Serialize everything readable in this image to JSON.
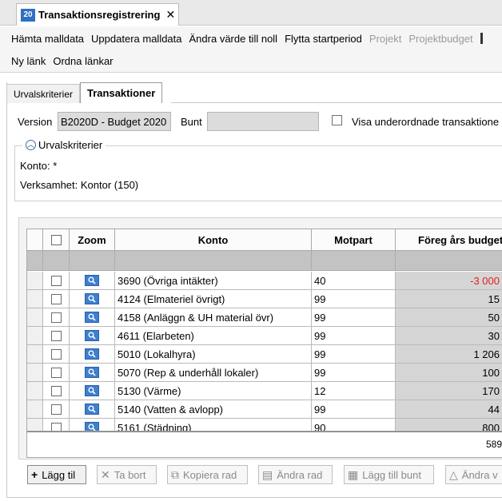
{
  "window": {
    "tab_icon_text": "20",
    "tab_title": "Transaktionsregistrering",
    "close_glyph": "✕"
  },
  "toolbar": {
    "row1": [
      {
        "label": "Hämta malldata",
        "enabled": true
      },
      {
        "label": "Uppdatera malldata",
        "enabled": true
      },
      {
        "label": "Ändra värde till noll",
        "enabled": true
      },
      {
        "label": "Flytta startperiod",
        "enabled": true
      },
      {
        "label": "Projekt",
        "enabled": false
      },
      {
        "label": "Projektbudget",
        "enabled": false
      }
    ],
    "row2": [
      {
        "label": "Ny länk",
        "enabled": true
      },
      {
        "label": "Ordna länkar",
        "enabled": true
      }
    ]
  },
  "tabs": [
    {
      "label": "Urvalskriterier",
      "active": false
    },
    {
      "label": "Transaktioner",
      "active": true
    }
  ],
  "form": {
    "version_label": "Version",
    "version_value": "B2020D - Budget 2020",
    "bunt_label": "Bunt",
    "bunt_value": "",
    "show_sub_label": "Visa underordnade transaktione"
  },
  "criteria": {
    "legend": "Urvalskriterier",
    "line1": "Konto: *",
    "line2": "Verksamhet: Kontor (150)"
  },
  "grid": {
    "headers": {
      "zoom": "Zoom",
      "konto": "Konto",
      "motpart": "Motpart",
      "budget": "Föreg års budget"
    },
    "rows": [
      {
        "konto": "3690 (Övriga intäkter)",
        "motpart": "40",
        "budget": "-3 000",
        "negative": true
      },
      {
        "konto": "4124 (Elmateriel övrigt)",
        "motpart": "99",
        "budget": "15",
        "negative": false
      },
      {
        "konto": "4158 (Anläggn & UH material övr)",
        "motpart": "99",
        "budget": "50",
        "negative": false
      },
      {
        "konto": "4611 (Elarbeten)",
        "motpart": "99",
        "budget": "30",
        "negative": false
      },
      {
        "konto": "5010 (Lokalhyra)",
        "motpart": "99",
        "budget": "1 206",
        "negative": false
      },
      {
        "konto": "5070 (Rep & underhåll lokaler)",
        "motpart": "99",
        "budget": "100",
        "negative": false
      },
      {
        "konto": "5130 (Värme)",
        "motpart": "12",
        "budget": "170",
        "negative": false
      },
      {
        "konto": "5140 (Vatten & avlopp)",
        "motpart": "99",
        "budget": "44",
        "negative": false
      },
      {
        "konto": "5161 (Städning)",
        "motpart": "90",
        "budget": "800",
        "negative": false
      }
    ],
    "sum": "589"
  },
  "buttons": [
    {
      "label": "Lägg til",
      "icon": "plus-icon",
      "enabled": true
    },
    {
      "label": "Ta bort",
      "icon": "remove-icon",
      "enabled": false
    },
    {
      "label": "Kopiera rad",
      "icon": "copy-icon",
      "enabled": false
    },
    {
      "label": "Ändra rad",
      "icon": "edit-row-icon",
      "enabled": false
    },
    {
      "label": "Lägg till bunt",
      "icon": "add-batch-icon",
      "enabled": false
    },
    {
      "label": "Ändra v",
      "icon": "warning-icon",
      "enabled": false
    }
  ]
}
